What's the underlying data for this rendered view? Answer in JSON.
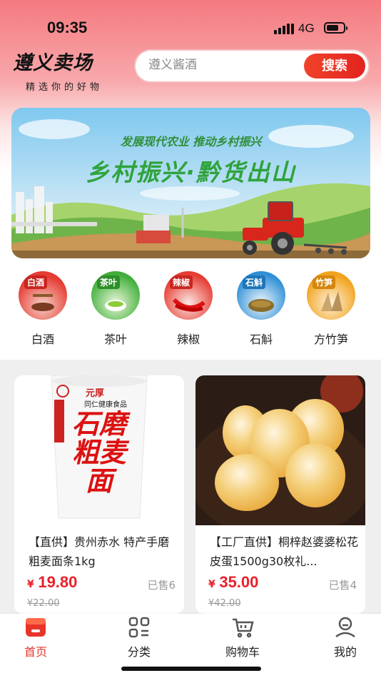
{
  "status_bar": {
    "time": "09:35",
    "network": "4G"
  },
  "brand": {
    "title": "遵义卖场",
    "subtitle": "精选你的好物"
  },
  "search": {
    "placeholder": "遵义酱酒",
    "button_label": "搜索"
  },
  "banner": {
    "tagline": "发展现代农业  推动乡村振兴",
    "title": "乡村振兴·黔货出山"
  },
  "categories": [
    {
      "label": "白酒",
      "tag": "白酒",
      "color": "#e53c33",
      "icon": "baijiu-icon"
    },
    {
      "label": "茶叶",
      "tag": "茶叶",
      "color": "#3fae3a",
      "icon": "tea-icon"
    },
    {
      "label": "辣椒",
      "tag": "辣椒",
      "color": "#e53c33",
      "icon": "chili-icon"
    },
    {
      "label": "石斛",
      "tag": "石斛",
      "color": "#2e8fd6",
      "icon": "dendrobium-icon"
    },
    {
      "label": "方竹笋",
      "tag": "竹笋",
      "color": "#f2a21b",
      "icon": "bamboo-shoot-icon"
    }
  ],
  "products": [
    {
      "title": "【直供】贵州赤水 特产手磨粗麦面条1kg",
      "price_symbol": "¥",
      "price": "19.80",
      "original_price": "¥22.00",
      "sold": "已售6",
      "package_brand": "元厚",
      "package_name": "石磨粗麦面",
      "package_tag": "同仁健康食品"
    },
    {
      "title": "【工厂直供】桐梓赵婆婆松花皮蛋1500g30枚礼...",
      "price_symbol": "¥",
      "price": "35.00",
      "original_price": "¥42.00",
      "sold": "已售4"
    }
  ],
  "tabbar": [
    {
      "label": "首页",
      "icon": "home-store-icon",
      "active": true
    },
    {
      "label": "分类",
      "icon": "category-grid-icon",
      "active": false
    },
    {
      "label": "购物车",
      "icon": "cart-icon",
      "active": false
    },
    {
      "label": "我的",
      "icon": "profile-icon",
      "active": false
    }
  ],
  "colors": {
    "accent": "#e8352b",
    "price": "#e8202a",
    "header_pink": "#f47a80"
  }
}
